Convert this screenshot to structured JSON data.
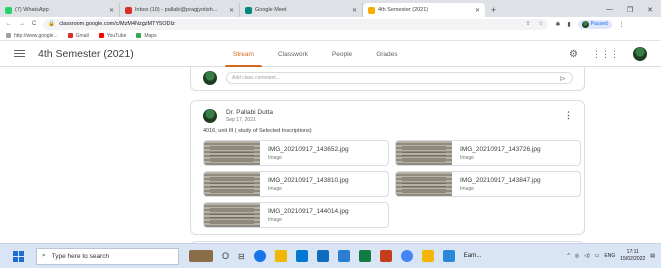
{
  "browser": {
    "tabs": [
      {
        "label": "(7) WhatsApp",
        "color": "#25d366"
      },
      {
        "label": "Inbox (10) - pallabi@pragjyotish...",
        "color": "#d93025"
      },
      {
        "label": "Google Meet",
        "color": "#00897b"
      },
      {
        "label": "4th Semester (2021)",
        "color": "#f9ab00"
      }
    ],
    "new_tab": "+",
    "url": "classroom.google.com/c/MzM4NzgzMTY5ODIz",
    "profile_label": "Paused",
    "bookmarks": [
      {
        "label": "http://www.google...",
        "color": "#9aa0a6"
      },
      {
        "label": "Gmail",
        "color": "#d93025"
      },
      {
        "label": "YouTube",
        "color": "#ff0000"
      },
      {
        "label": "Maps",
        "color": "#34a853"
      }
    ]
  },
  "classroom": {
    "title": "4th Semester (2021)",
    "tabs": [
      {
        "label": "Stream",
        "active": true
      },
      {
        "label": "Classwork",
        "active": false
      },
      {
        "label": "People",
        "active": false
      },
      {
        "label": "Grades",
        "active": false
      }
    ],
    "accent_color": "#d2691e"
  },
  "stream": {
    "comment_placeholder": "Add class comment...",
    "post": {
      "author": "Dr. Pallabi Dutta",
      "date": "Sep 17, 2021",
      "text": "4016, unit III ( study of Selected Inscriptions)",
      "attachments": [
        {
          "name": "IMG_20210917_143652.jpg",
          "type": "Image"
        },
        {
          "name": "IMG_20210917_143726.jpg",
          "type": "Image"
        },
        {
          "name": "IMG_20210917_143810.jpg",
          "type": "Image"
        },
        {
          "name": "IMG_20210917_143847.jpg",
          "type": "Image"
        },
        {
          "name": "IMG_20210917_144014.jpg",
          "type": "Image"
        }
      ]
    }
  },
  "taskbar": {
    "search_placeholder": "Type here to search",
    "app_label": "Earn...",
    "lang": "ENG",
    "time": "17:11",
    "date": "15/02/2022"
  }
}
